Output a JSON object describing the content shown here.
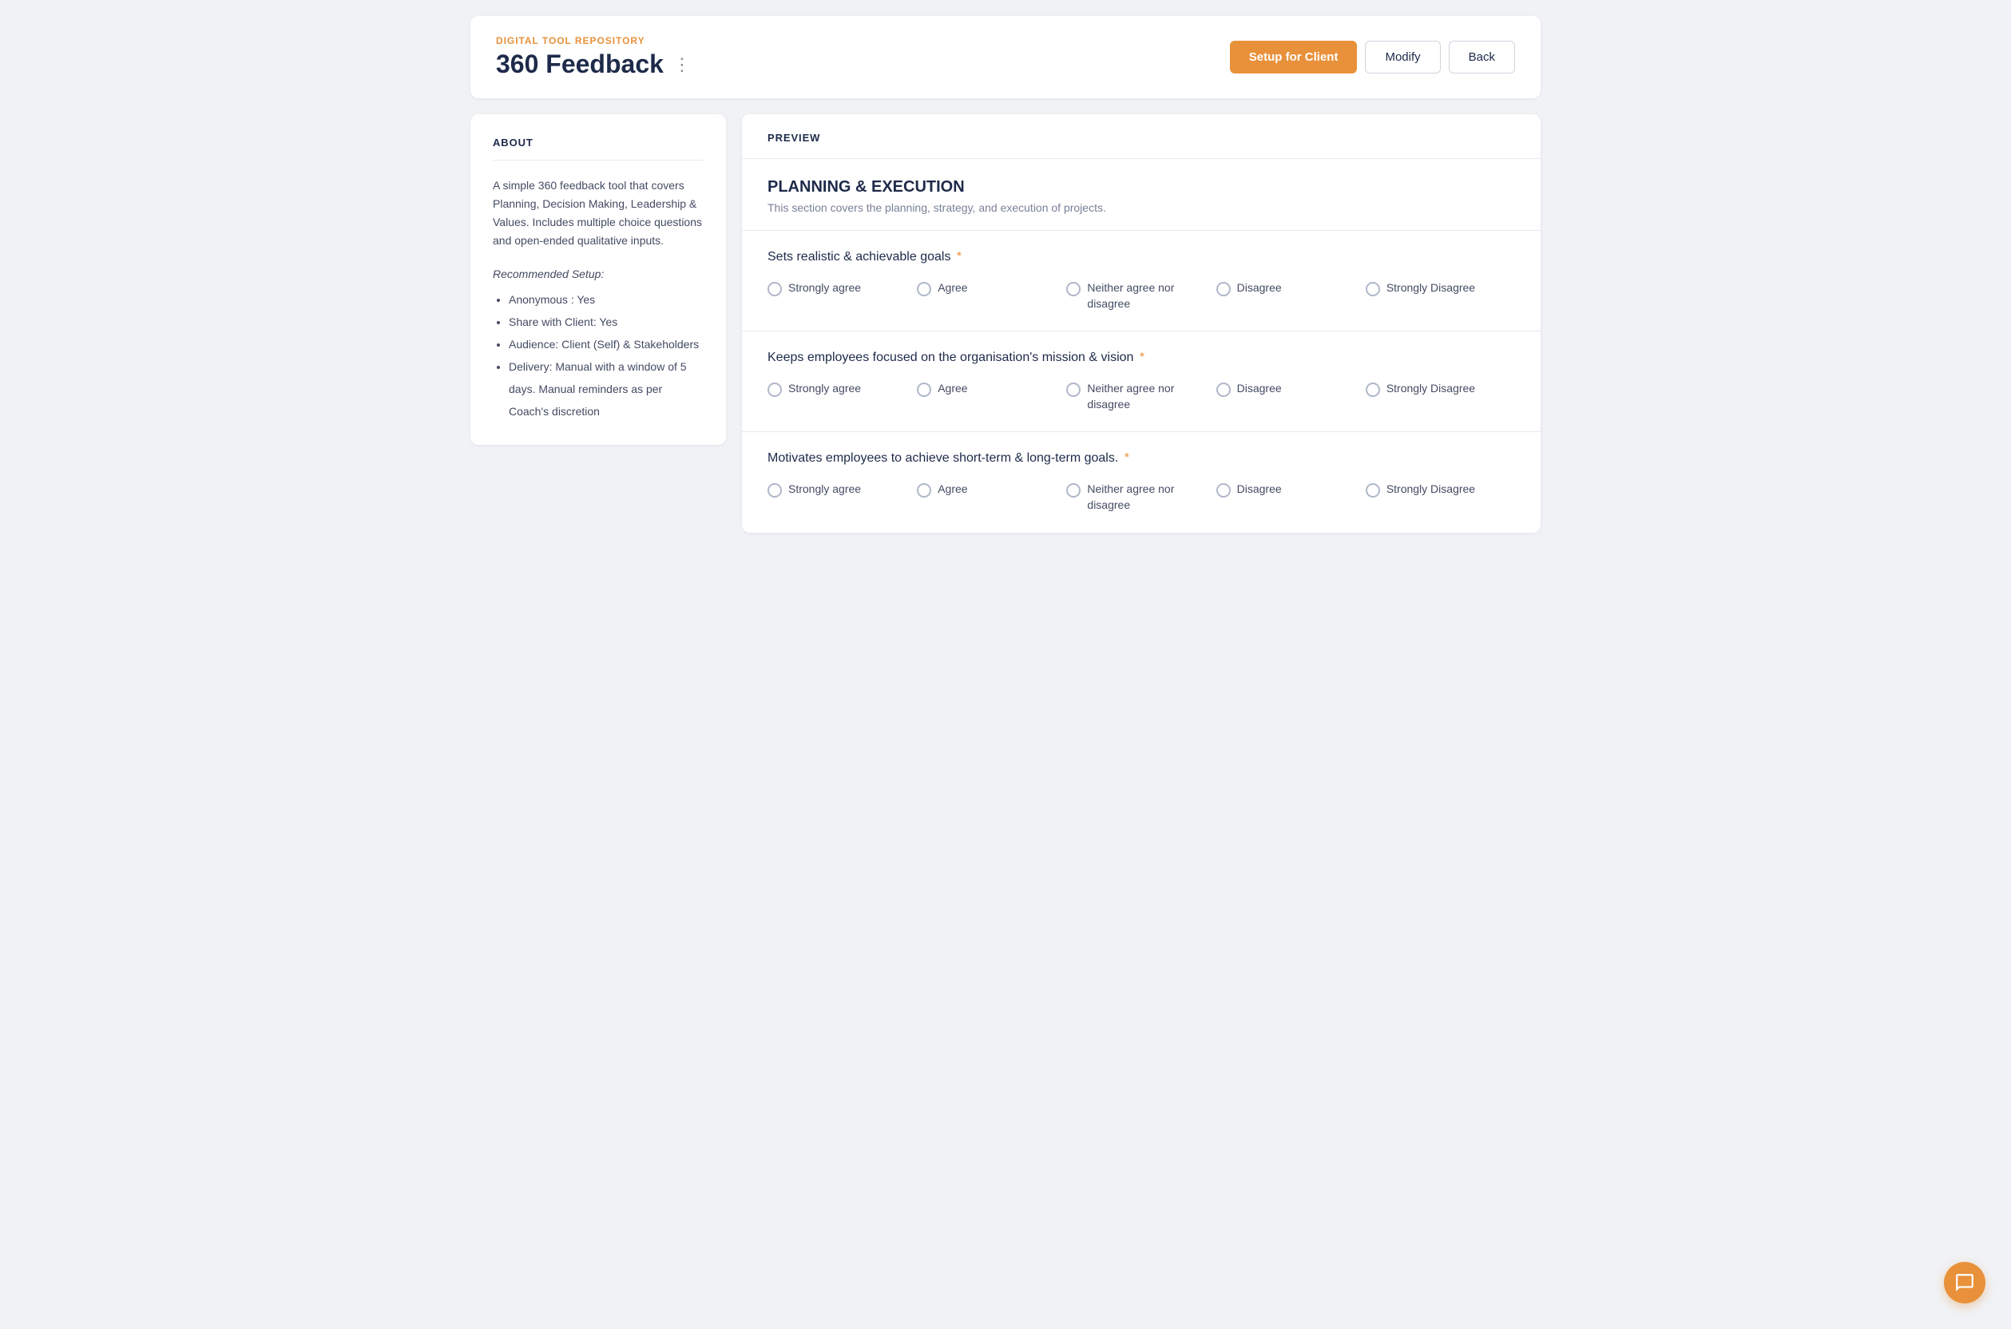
{
  "header": {
    "repo_label": "DIGITAL TOOL REPOSITORY",
    "title": "360 Feedback",
    "more_icon": "⋮",
    "actions": {
      "setup_label": "Setup for Client",
      "modify_label": "Modify",
      "back_label": "Back"
    }
  },
  "about": {
    "section_label": "ABOUT",
    "description": "A simple 360 feedback tool that covers Planning, Decision Making, Leadership & Values. Includes multiple choice questions and open-ended qualitative inputs.",
    "recommended_title": "Recommended Setup:",
    "items": [
      "Anonymous : Yes",
      "Share with Client: Yes",
      "Audience: Client (Self) & Stakeholders",
      "Delivery: Manual with a window of 5 days. Manual reminders as per Coach's discretion"
    ]
  },
  "preview": {
    "section_label": "PREVIEW",
    "section_title": "PLANNING & EXECUTION",
    "section_subtitle": "This section covers the planning, strategy, and execution of projects.",
    "questions": [
      {
        "text": "Sets realistic & achievable goals",
        "required": true,
        "options": [
          "Strongly agree",
          "Agree",
          "Neither agree nor disagree",
          "Disagree",
          "Strongly Disagree"
        ]
      },
      {
        "text": "Keeps employees focused on the organisation's mission & vision",
        "required": true,
        "options": [
          "Strongly agree",
          "Agree",
          "Neither agree nor disagree",
          "Disagree",
          "Strongly Disagree"
        ]
      },
      {
        "text": "Motivates employees to achieve short-term & long-term goals.",
        "required": true,
        "options": [
          "Strongly agree",
          "Agree",
          "Neither agree nor disagree",
          "Disagree",
          "Strongly Disagree"
        ]
      }
    ]
  }
}
